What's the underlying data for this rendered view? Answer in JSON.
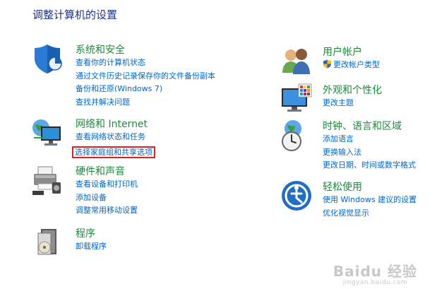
{
  "page_title": "调整计算机的设置",
  "left": [
    {
      "title": "系统和安全",
      "icon": "shield-icon",
      "links": [
        "查看你的计算机状态",
        "通过文件历史记录保存你的文件备份副本",
        "备份和还原(Windows 7)",
        "查找并解决问题"
      ]
    },
    {
      "title": "网络和 Internet",
      "icon": "network-globe-icon",
      "links": [
        "查看网络状态和任务",
        "选择家庭组和共享选项"
      ]
    },
    {
      "title": "硬件和声音",
      "icon": "printer-icon",
      "links": [
        "查看设备和打印机",
        "添加设备",
        "调整常用移动设置"
      ]
    },
    {
      "title": "程序",
      "icon": "program-disc-icon",
      "links": [
        "卸载程序"
      ]
    }
  ],
  "right": [
    {
      "title": "用户帐户",
      "icon": "users-icon",
      "links": [
        "更改帐户类型"
      ]
    },
    {
      "title": "外观和个性化",
      "icon": "monitor-colors-icon",
      "links": [
        "更改主题"
      ]
    },
    {
      "title": "时钟、语言和区域",
      "icon": "clock-globe-icon",
      "links": [
        "添加语言",
        "更换输入法",
        "更改日期、时间或数字格式"
      ]
    },
    {
      "title": "轻松使用",
      "icon": "ease-of-access-icon",
      "links": [
        "使用 Windows 建议的设置",
        "优化视觉显示"
      ]
    }
  ],
  "highlighted_link": "选择家庭组和共享选项",
  "watermark": {
    "main": "Baidu 经验",
    "sub": "jingyan.baidu.com"
  },
  "colors": {
    "title": "#1e3287",
    "category": "#1e8a3c",
    "link": "#0066cc",
    "highlight": "#e02020"
  }
}
